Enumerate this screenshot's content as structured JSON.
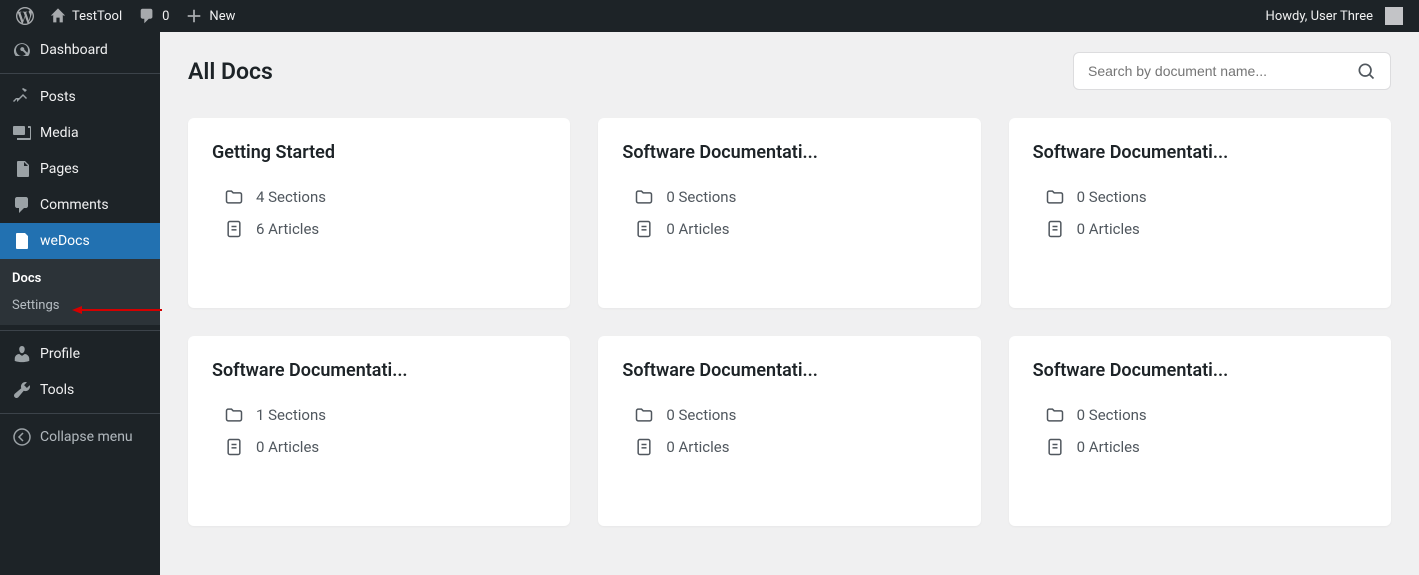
{
  "adminBar": {
    "siteName": "TestTool",
    "commentCount": "0",
    "newLabel": "New",
    "greeting": "Howdy, User Three"
  },
  "sidebar": {
    "dashboard": "Dashboard",
    "posts": "Posts",
    "media": "Media",
    "pages": "Pages",
    "comments": "Comments",
    "wedocs": "weDocs",
    "subDocs": "Docs",
    "subSettings": "Settings",
    "profile": "Profile",
    "tools": "Tools",
    "collapse": "Collapse menu"
  },
  "page": {
    "title": "All Docs",
    "searchPlaceholder": "Search by document name..."
  },
  "cards": [
    {
      "title": "Getting Started",
      "sections": "4 Sections",
      "articles": "6 Articles"
    },
    {
      "title": "Software Documentati...",
      "sections": "0 Sections",
      "articles": "0 Articles"
    },
    {
      "title": "Software Documentati...",
      "sections": "0 Sections",
      "articles": "0 Articles"
    },
    {
      "title": "Software Documentati...",
      "sections": "1 Sections",
      "articles": "0 Articles"
    },
    {
      "title": "Software Documentati...",
      "sections": "0 Sections",
      "articles": "0 Articles"
    },
    {
      "title": "Software Documentati...",
      "sections": "0 Sections",
      "articles": "0 Articles"
    }
  ]
}
